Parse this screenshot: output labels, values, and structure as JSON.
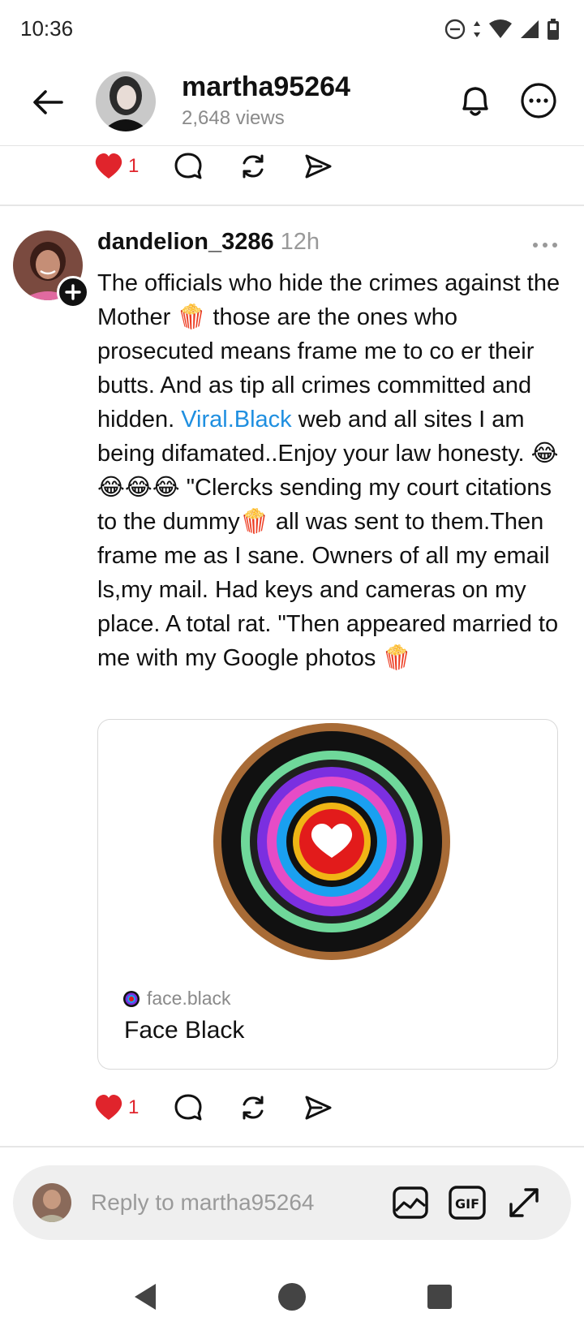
{
  "status_bar": {
    "time": "10:36"
  },
  "header": {
    "username": "martha95264",
    "views": "2,648 views"
  },
  "top_actions": {
    "like_count": "1"
  },
  "reply": {
    "author": "dandelion_3286",
    "time": "12h",
    "text_before_link": "The officials who hide the crimes against the Mother 🍿 those are the ones who prosecuted means frame me to co er their butts. And as tip all crimes committed and hidden. ",
    "link_text": "Viral.Black",
    "text_after_link": " web and all sites I am being difamated..Enjoy your law honesty. 😂😂😂😂 \"Clercks sending my court citations to the dummy🍿 all was sent to them.Then frame me as I sane. Owners of all my email ls,my mail. Had keys and cameras on my place. A total rat. \"Then appeared married to me with my Google photos 🍿",
    "card": {
      "domain": "face.black",
      "title": "Face Black"
    },
    "like_count": "1"
  },
  "composer": {
    "placeholder": "Reply to martha95264",
    "gif_label": "GIF"
  },
  "colors": {
    "like": "#e0242c",
    "link": "#1f8fe0"
  }
}
